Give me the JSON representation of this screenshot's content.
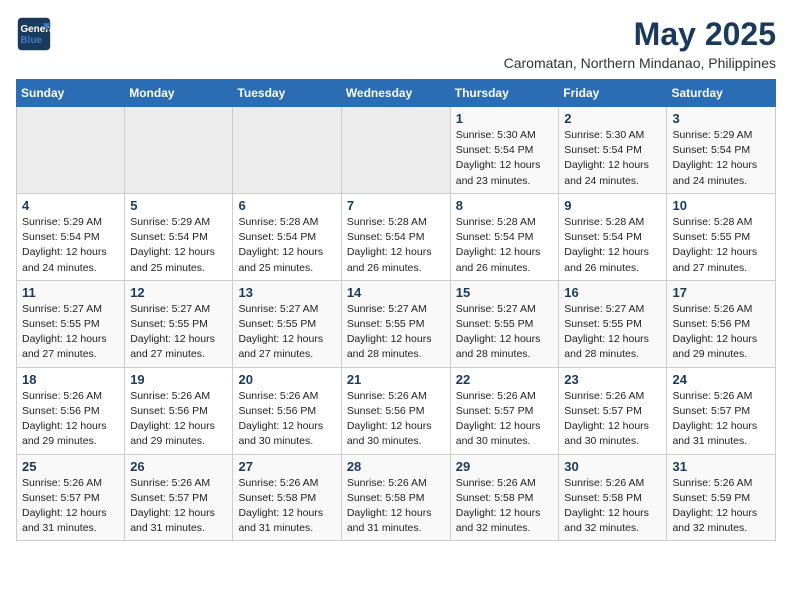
{
  "header": {
    "logo_line1": "General",
    "logo_line2": "Blue",
    "title": "May 2025",
    "subtitle": "Caromatan, Northern Mindanao, Philippines"
  },
  "weekdays": [
    "Sunday",
    "Monday",
    "Tuesday",
    "Wednesday",
    "Thursday",
    "Friday",
    "Saturday"
  ],
  "weeks": [
    [
      {
        "day": "",
        "detail": ""
      },
      {
        "day": "",
        "detail": ""
      },
      {
        "day": "",
        "detail": ""
      },
      {
        "day": "",
        "detail": ""
      },
      {
        "day": "1",
        "detail": "Sunrise: 5:30 AM\nSunset: 5:54 PM\nDaylight: 12 hours\nand 23 minutes."
      },
      {
        "day": "2",
        "detail": "Sunrise: 5:30 AM\nSunset: 5:54 PM\nDaylight: 12 hours\nand 24 minutes."
      },
      {
        "day": "3",
        "detail": "Sunrise: 5:29 AM\nSunset: 5:54 PM\nDaylight: 12 hours\nand 24 minutes."
      }
    ],
    [
      {
        "day": "4",
        "detail": "Sunrise: 5:29 AM\nSunset: 5:54 PM\nDaylight: 12 hours\nand 24 minutes."
      },
      {
        "day": "5",
        "detail": "Sunrise: 5:29 AM\nSunset: 5:54 PM\nDaylight: 12 hours\nand 25 minutes."
      },
      {
        "day": "6",
        "detail": "Sunrise: 5:28 AM\nSunset: 5:54 PM\nDaylight: 12 hours\nand 25 minutes."
      },
      {
        "day": "7",
        "detail": "Sunrise: 5:28 AM\nSunset: 5:54 PM\nDaylight: 12 hours\nand 26 minutes."
      },
      {
        "day": "8",
        "detail": "Sunrise: 5:28 AM\nSunset: 5:54 PM\nDaylight: 12 hours\nand 26 minutes."
      },
      {
        "day": "9",
        "detail": "Sunrise: 5:28 AM\nSunset: 5:54 PM\nDaylight: 12 hours\nand 26 minutes."
      },
      {
        "day": "10",
        "detail": "Sunrise: 5:28 AM\nSunset: 5:55 PM\nDaylight: 12 hours\nand 27 minutes."
      }
    ],
    [
      {
        "day": "11",
        "detail": "Sunrise: 5:27 AM\nSunset: 5:55 PM\nDaylight: 12 hours\nand 27 minutes."
      },
      {
        "day": "12",
        "detail": "Sunrise: 5:27 AM\nSunset: 5:55 PM\nDaylight: 12 hours\nand 27 minutes."
      },
      {
        "day": "13",
        "detail": "Sunrise: 5:27 AM\nSunset: 5:55 PM\nDaylight: 12 hours\nand 27 minutes."
      },
      {
        "day": "14",
        "detail": "Sunrise: 5:27 AM\nSunset: 5:55 PM\nDaylight: 12 hours\nand 28 minutes."
      },
      {
        "day": "15",
        "detail": "Sunrise: 5:27 AM\nSunset: 5:55 PM\nDaylight: 12 hours\nand 28 minutes."
      },
      {
        "day": "16",
        "detail": "Sunrise: 5:27 AM\nSunset: 5:55 PM\nDaylight: 12 hours\nand 28 minutes."
      },
      {
        "day": "17",
        "detail": "Sunrise: 5:26 AM\nSunset: 5:56 PM\nDaylight: 12 hours\nand 29 minutes."
      }
    ],
    [
      {
        "day": "18",
        "detail": "Sunrise: 5:26 AM\nSunset: 5:56 PM\nDaylight: 12 hours\nand 29 minutes."
      },
      {
        "day": "19",
        "detail": "Sunrise: 5:26 AM\nSunset: 5:56 PM\nDaylight: 12 hours\nand 29 minutes."
      },
      {
        "day": "20",
        "detail": "Sunrise: 5:26 AM\nSunset: 5:56 PM\nDaylight: 12 hours\nand 30 minutes."
      },
      {
        "day": "21",
        "detail": "Sunrise: 5:26 AM\nSunset: 5:56 PM\nDaylight: 12 hours\nand 30 minutes."
      },
      {
        "day": "22",
        "detail": "Sunrise: 5:26 AM\nSunset: 5:57 PM\nDaylight: 12 hours\nand 30 minutes."
      },
      {
        "day": "23",
        "detail": "Sunrise: 5:26 AM\nSunset: 5:57 PM\nDaylight: 12 hours\nand 30 minutes."
      },
      {
        "day": "24",
        "detail": "Sunrise: 5:26 AM\nSunset: 5:57 PM\nDaylight: 12 hours\nand 31 minutes."
      }
    ],
    [
      {
        "day": "25",
        "detail": "Sunrise: 5:26 AM\nSunset: 5:57 PM\nDaylight: 12 hours\nand 31 minutes."
      },
      {
        "day": "26",
        "detail": "Sunrise: 5:26 AM\nSunset: 5:57 PM\nDaylight: 12 hours\nand 31 minutes."
      },
      {
        "day": "27",
        "detail": "Sunrise: 5:26 AM\nSunset: 5:58 PM\nDaylight: 12 hours\nand 31 minutes."
      },
      {
        "day": "28",
        "detail": "Sunrise: 5:26 AM\nSunset: 5:58 PM\nDaylight: 12 hours\nand 31 minutes."
      },
      {
        "day": "29",
        "detail": "Sunrise: 5:26 AM\nSunset: 5:58 PM\nDaylight: 12 hours\nand 32 minutes."
      },
      {
        "day": "30",
        "detail": "Sunrise: 5:26 AM\nSunset: 5:58 PM\nDaylight: 12 hours\nand 32 minutes."
      },
      {
        "day": "31",
        "detail": "Sunrise: 5:26 AM\nSunset: 5:59 PM\nDaylight: 12 hours\nand 32 minutes."
      }
    ]
  ]
}
